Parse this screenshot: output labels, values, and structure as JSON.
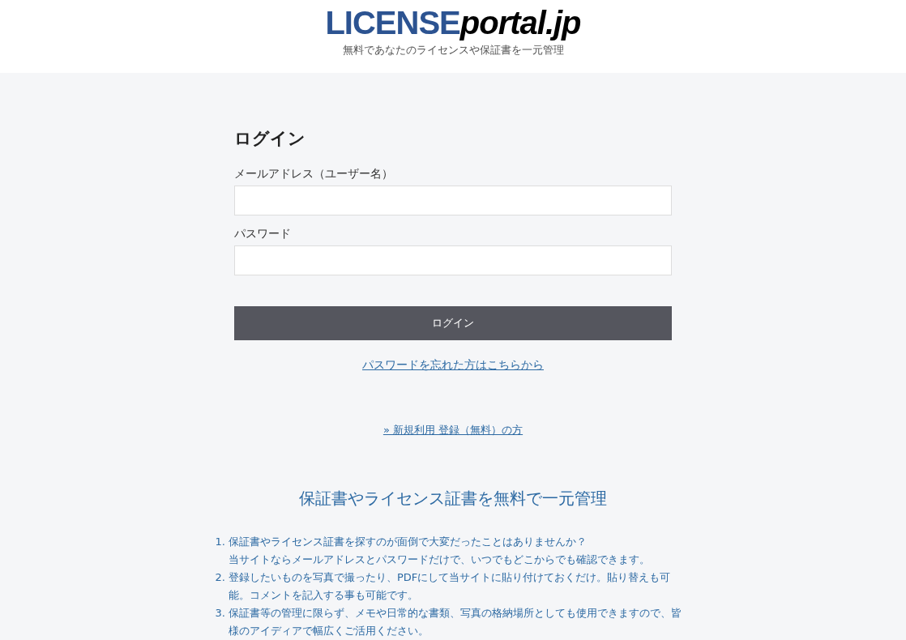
{
  "header": {
    "logo_primary": "LICENSE",
    "logo_secondary": "portal.jp",
    "tagline": "無料であなたのライセンスや保証書を一元管理"
  },
  "login": {
    "title": "ログイン",
    "fields": [
      {
        "label": "メールアドレス（ユーザー名）"
      },
      {
        "label": "パスワード"
      }
    ],
    "button": "ログイン",
    "forgot_link": "パスワードを忘れた方はこちらから",
    "register_link": "» 新規利用 登録（無料）の方"
  },
  "features": {
    "heading": "保証書やライセンス証書を無料で一元管理",
    "items": [
      {
        "number": "1.",
        "lines": [
          "保証書やライセンス証書を探すのが面倒で大変だったことはありませんか？",
          "当サイトならメールアドレスとパスワードだけで、いつでもどこからでも確認できます。"
        ]
      },
      {
        "number": "2.",
        "lines": [
          "登録したいものを写真で撮ったり、PDFにして当サイトに貼り付けておくだけ。貼り替えも可能。コメントを記入する事も可能です。"
        ]
      },
      {
        "number": "3.",
        "lines": [
          "保証書等の管理に限らず、メモや日常的な書類、写真の格納場所としても使用できますので、皆様のアイディアで幅広くご活用ください。"
        ]
      }
    ]
  }
}
